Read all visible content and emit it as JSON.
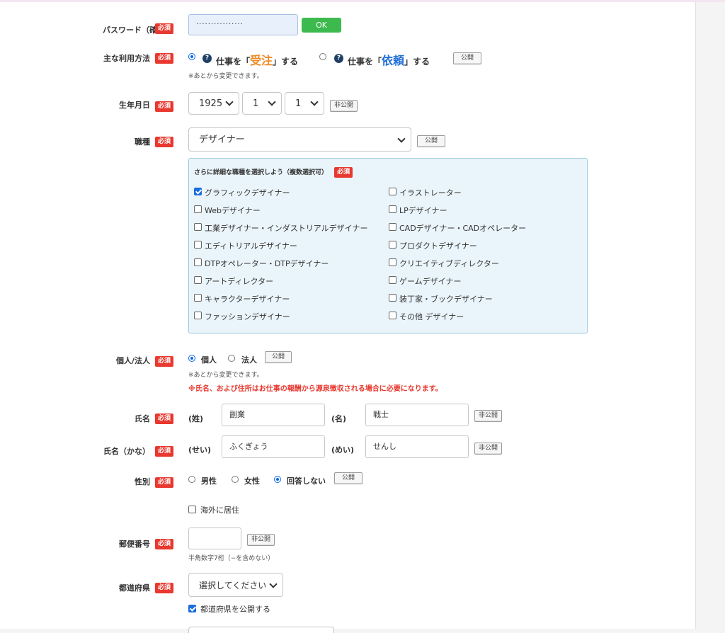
{
  "required_badge": "必須",
  "password_confirm": {
    "label": "パスワード（確認）",
    "value": "················",
    "ok_button": "OK"
  },
  "usage": {
    "label": "主な利用方法",
    "option1_pre": "仕事を「",
    "option1_key": "受注",
    "option1_post": "」する",
    "option2_pre": "仕事を「",
    "option2_key": "依頼",
    "option2_post": "」する",
    "visibility": "公開",
    "note": "※あとから変更できます。",
    "selected": "受注"
  },
  "birthday": {
    "label": "生年月日",
    "year": "1925",
    "month": "1",
    "day": "1",
    "visibility": "非公開"
  },
  "occupation": {
    "label": "職種",
    "selected": "デザイナー",
    "visibility": "公開"
  },
  "detail": {
    "title": "さらに詳細な職種を選択しよう（複数選択可）",
    "left": [
      {
        "label": "グラフィックデザイナー",
        "checked": true
      },
      {
        "label": "Webデザイナー",
        "checked": false
      },
      {
        "label": "工業デザイナー・インダストリアルデザイナー",
        "checked": false
      },
      {
        "label": "エディトリアルデザイナー",
        "checked": false
      },
      {
        "label": "DTPオペレーター・DTPデザイナー",
        "checked": false
      },
      {
        "label": "アートディレクター",
        "checked": false
      },
      {
        "label": "キャラクターデザイナー",
        "checked": false
      },
      {
        "label": "ファッションデザイナー",
        "checked": false
      }
    ],
    "right": [
      {
        "label": "イラストレーター",
        "checked": false
      },
      {
        "label": "LPデザイナー",
        "checked": false
      },
      {
        "label": "CADデザイナー・CADオペレーター",
        "checked": false
      },
      {
        "label": "プロダクトデザイナー",
        "checked": false
      },
      {
        "label": "クリエイティブディレクター",
        "checked": false
      },
      {
        "label": "ゲームデザイナー",
        "checked": false
      },
      {
        "label": "装丁家・ブックデザイナー",
        "checked": false
      },
      {
        "label": "その他 デザイナー",
        "checked": false
      }
    ]
  },
  "entity": {
    "label": "個人/法人",
    "opt_individual": "個人",
    "opt_corporate": "法人",
    "selected": "個人",
    "visibility": "公開",
    "note": "※あとから変更できます。",
    "warning": "※氏名、および住所はお仕事の報酬から源泉徴収される場合に必要になります。"
  },
  "name": {
    "label": "氏名",
    "last_label": "(姓)",
    "last_value": "副業",
    "first_label": "(名)",
    "first_value": "戦士",
    "visibility": "非公開"
  },
  "kana": {
    "label": "氏名（かな）",
    "last_label": "(せい)",
    "last_value": "ふくぎょう",
    "first_label": "(めい)",
    "first_value": "せんし",
    "visibility": "非公開"
  },
  "gender": {
    "label": "性別",
    "male": "男性",
    "female": "女性",
    "no_answer": "回答しない",
    "selected": "回答しない",
    "visibility": "公開"
  },
  "overseas": {
    "label": "海外に居住",
    "checked": false
  },
  "postal": {
    "label": "郵便番号",
    "value": "",
    "visibility": "非公開",
    "note": "半角数字7桁（−を含めない）"
  },
  "prefecture": {
    "label": "都道府県",
    "selected": "選択してください",
    "publish_label": "都道府県を公開する",
    "publish_checked": true
  }
}
